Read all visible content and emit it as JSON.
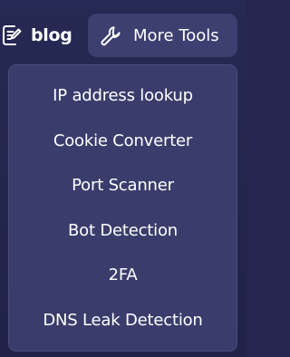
{
  "nav": {
    "blog_label": "blog",
    "blog_icon": "document-edit-icon",
    "tools_label": "More Tools",
    "tools_icon": "wrench-icon"
  },
  "menu": {
    "items": [
      {
        "label": "IP address lookup"
      },
      {
        "label": "Cookie Converter"
      },
      {
        "label": "Port Scanner"
      },
      {
        "label": "Bot Detection"
      },
      {
        "label": "2FA"
      },
      {
        "label": "DNS Leak Detection"
      }
    ]
  },
  "colors": {
    "background": "#242650",
    "button": "#3c3f6f",
    "dropdown": "#3a3d6b",
    "text": "#ffffff"
  }
}
